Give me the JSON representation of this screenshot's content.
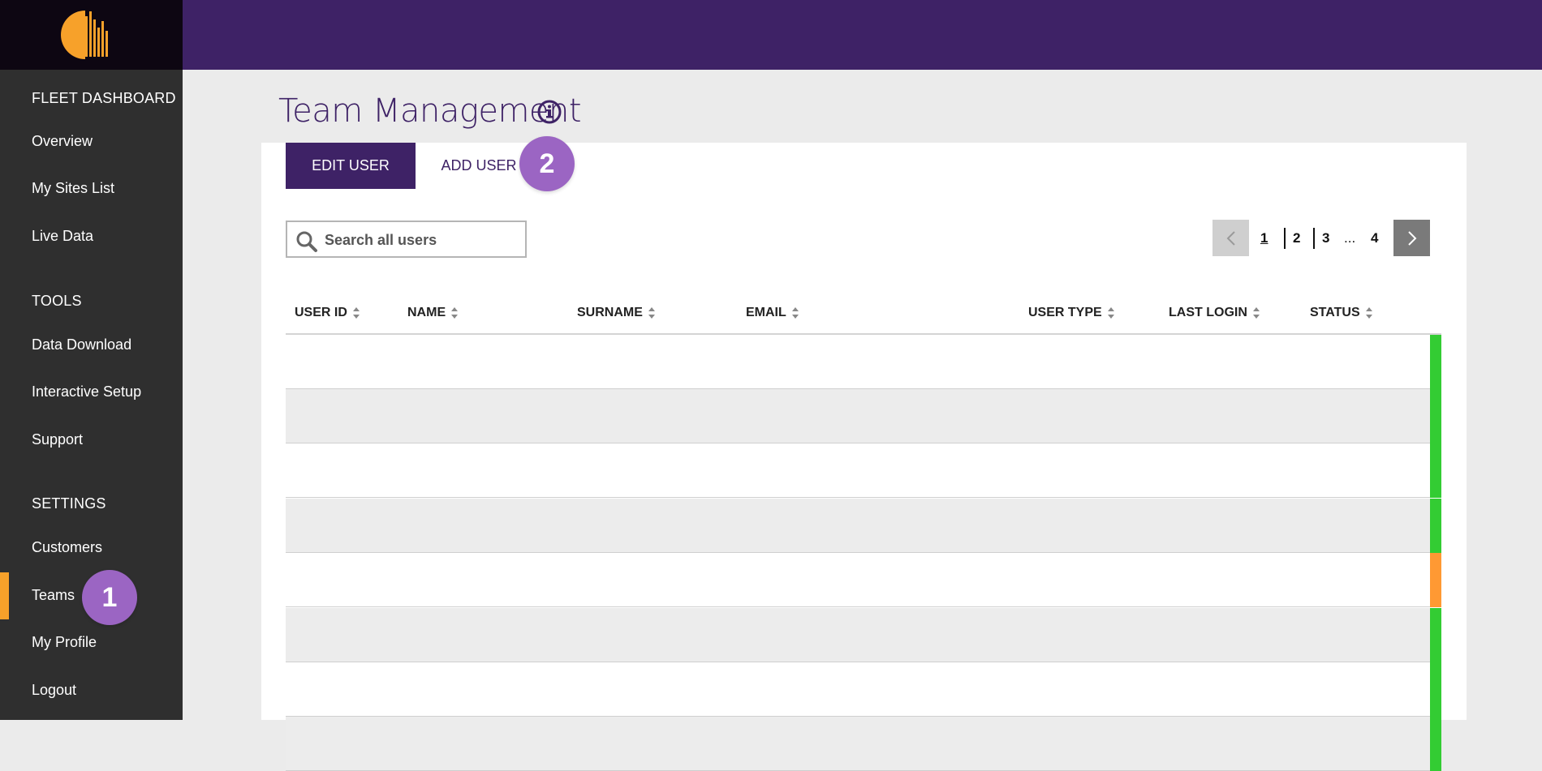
{
  "sidebar": {
    "sections": [
      {
        "label": "FLEET DASHBOARD",
        "items": [
          "Overview",
          "My Sites List",
          "Live Data"
        ]
      },
      {
        "label": "TOOLS",
        "items": [
          "Data Download",
          "Interactive Setup",
          "Support"
        ]
      },
      {
        "label": "SETTINGS",
        "items": [
          "Customers",
          "Teams",
          "My Profile",
          "Logout"
        ]
      }
    ],
    "active_item": "Teams",
    "accent_color": "#f7a12a"
  },
  "header": {
    "bar_color": "#3e2266"
  },
  "page": {
    "title": "Team Management",
    "info_icon": "info-icon",
    "tabs": {
      "edit_user": "EDIT USER",
      "add_user": "ADD USER"
    },
    "badges": {
      "teams": "1",
      "add_user": "2"
    }
  },
  "search": {
    "placeholder": "Search all users",
    "value": ""
  },
  "pagination": {
    "current": "1",
    "pages": [
      "1",
      "2",
      "3",
      "...",
      "4"
    ]
  },
  "table": {
    "columns": [
      "USER ID",
      "NAME",
      "SURNAME",
      "EMAIL",
      "USER TYPE",
      "LAST LOGIN",
      "STATUS"
    ],
    "row_status_colors": [
      "#33cc33",
      "#33cc33",
      "#33cc33",
      "#33cc33",
      "#ff9933",
      "#33cc33",
      "#33cc33",
      "#33cc33"
    ]
  }
}
